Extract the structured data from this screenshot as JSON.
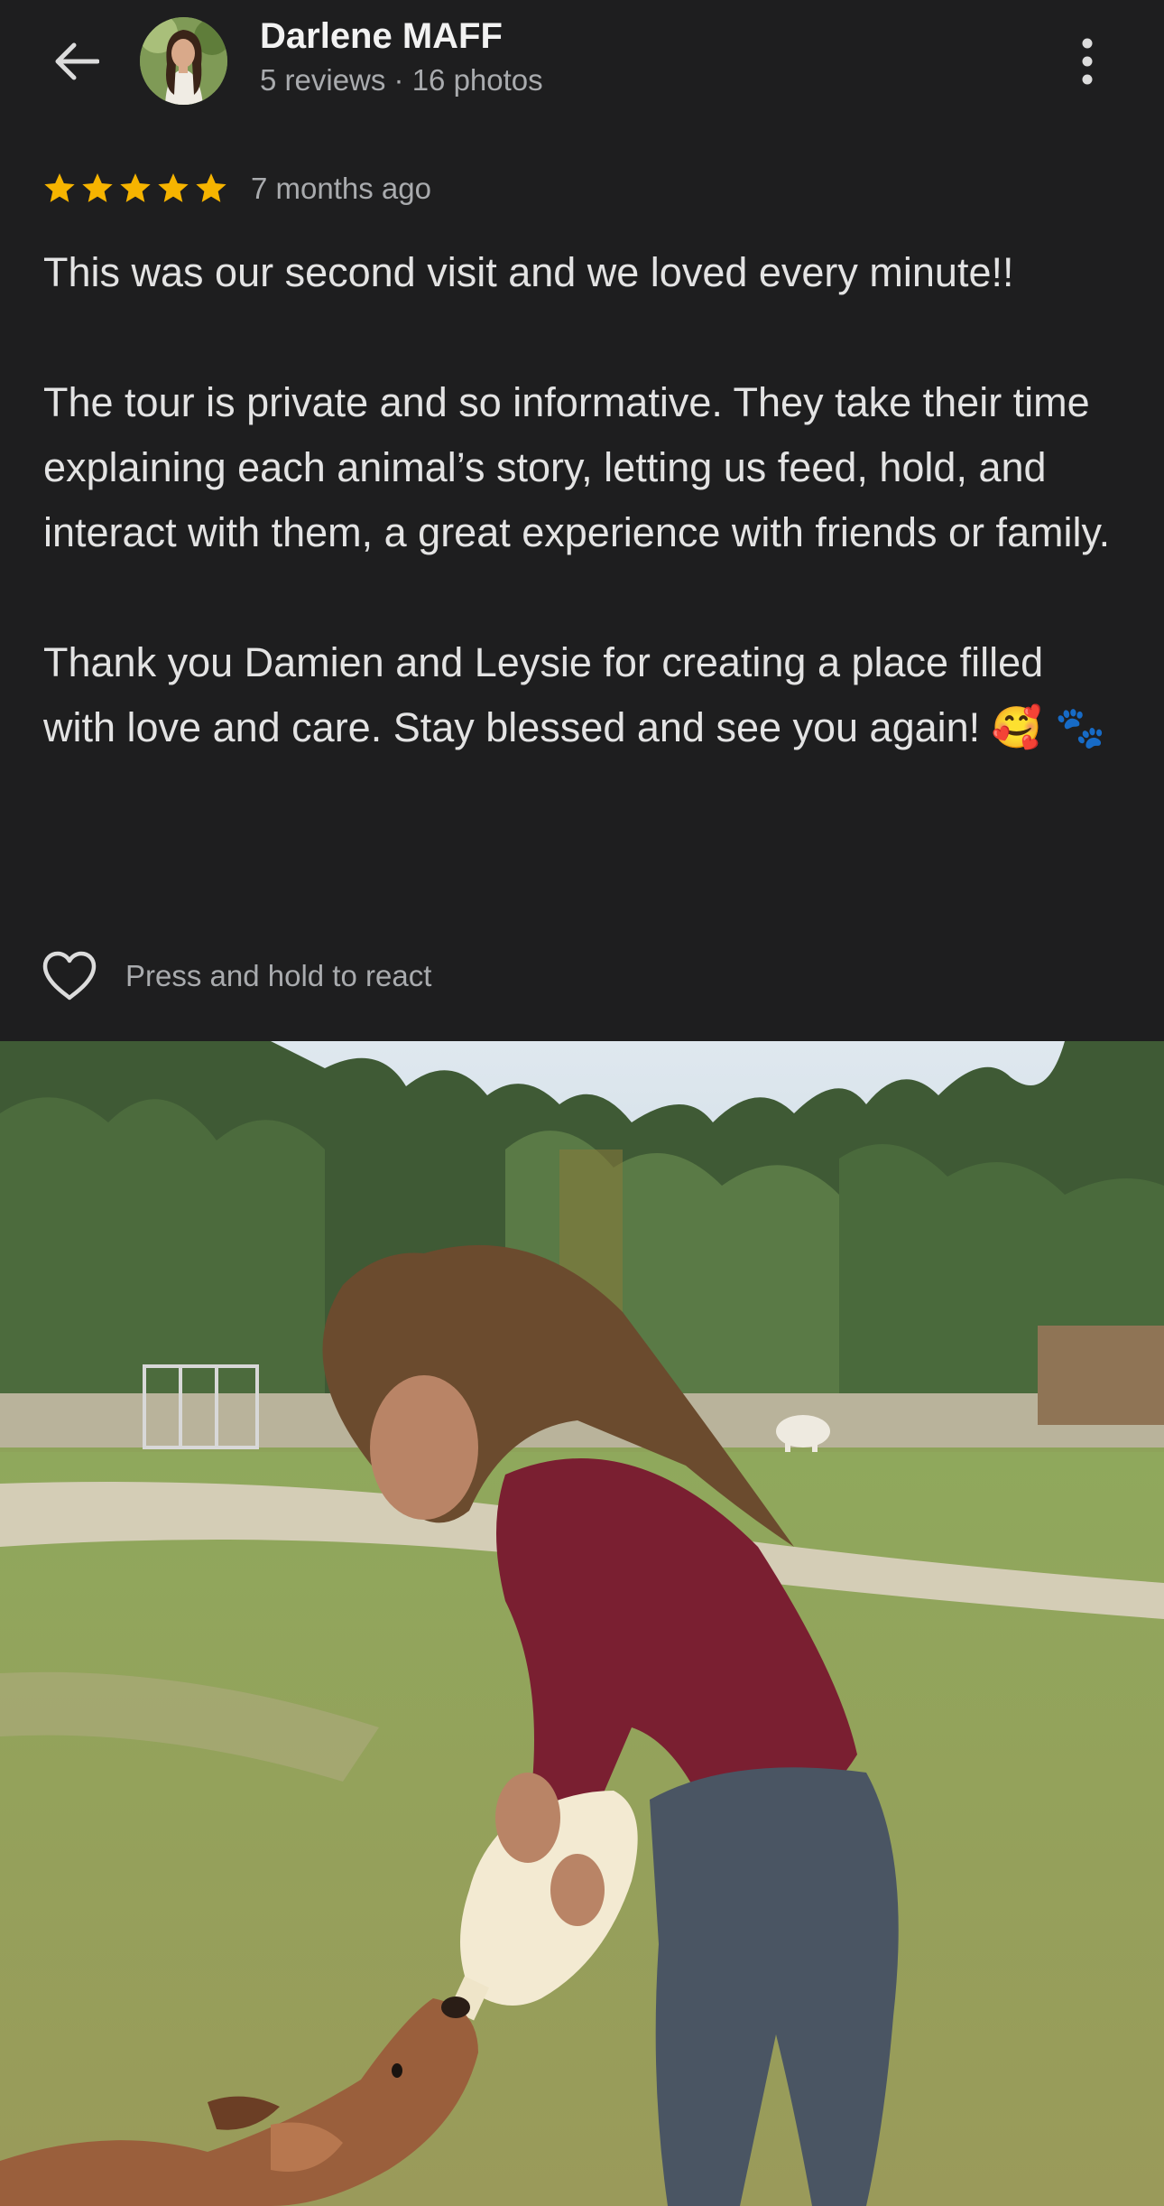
{
  "header": {
    "back_icon": "arrow-left-icon",
    "reviewer_name": "Darlene MAFF",
    "reviewer_meta": "5 reviews · 16 photos",
    "more_icon": "more-vertical-icon"
  },
  "review": {
    "rating": 5,
    "rating_max": 5,
    "star_color": "#f6b400",
    "age": "7 months ago",
    "paragraphs": [
      "This was our second visit and we loved every minute!!",
      "The tour is private and so informative. They take their time explaining each animal’s story, letting us feed, hold, and interact with them, a great experience with friends or family.",
      "Thank you Damien and Leysie for creating a place filled with love and care. Stay blessed and see you again!"
    ],
    "closing_emojis": "🥰 🐾"
  },
  "reaction": {
    "icon": "heart-outline-icon",
    "label": "Press and hold to react"
  },
  "photo": {
    "subject": "review-photo"
  },
  "colors": {
    "background": "#1e1e1f",
    "primary_text": "#e3e3e3",
    "secondary_text": "#a9abae"
  }
}
